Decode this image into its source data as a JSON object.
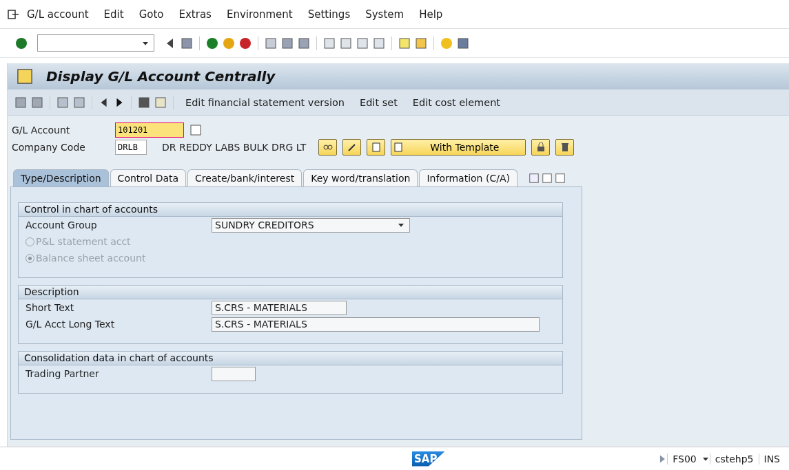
{
  "menu": [
    "G/L account",
    "Edit",
    "Goto",
    "Extras",
    "Environment",
    "Settings",
    "System",
    "Help"
  ],
  "title": "Display G/L Account Centrally",
  "app_toolbar": [
    "Edit financial statement version",
    "Edit set",
    "Edit cost element"
  ],
  "header": {
    "gl_account_label": "G/L Account",
    "gl_account": "101201",
    "company_code_label": "Company Code",
    "company_code": "DRLB",
    "company_name": "DR REDDY LABS BULK DRG LT",
    "template_button": "With Template"
  },
  "tabs": [
    {
      "label": "Type/Description",
      "selected": true
    },
    {
      "label": "Control Data",
      "selected": false
    },
    {
      "label": "Create/bank/interest",
      "selected": false
    },
    {
      "label": "Key word/translation",
      "selected": false
    },
    {
      "label": "Information (C/A)",
      "selected": false
    }
  ],
  "groups": [
    {
      "title": "Control in chart of accounts",
      "rows": [
        {
          "kind": "dropdown",
          "label": "Account Group",
          "value": "SUNDRY CREDITORS"
        },
        {
          "kind": "radio",
          "label": "P&L statement acct",
          "checked": false,
          "disabled": true
        },
        {
          "kind": "radio",
          "label": "Balance sheet account",
          "checked": true,
          "disabled": true
        }
      ]
    },
    {
      "title": "Description",
      "rows": [
        {
          "kind": "short",
          "label": "Short Text",
          "value": "S.CRS - MATERIALS"
        },
        {
          "kind": "long",
          "label": "G/L Acct Long Text",
          "value": "S.CRS - MATERIALS"
        }
      ]
    },
    {
      "title": "Consolidation data in chart of accounts",
      "rows": [
        {
          "kind": "tiny",
          "label": "Trading Partner"
        }
      ]
    }
  ],
  "status_bar": {
    "logo": "SAP",
    "transaction": "FS00",
    "server": "cstehp5",
    "mode": "INS"
  }
}
